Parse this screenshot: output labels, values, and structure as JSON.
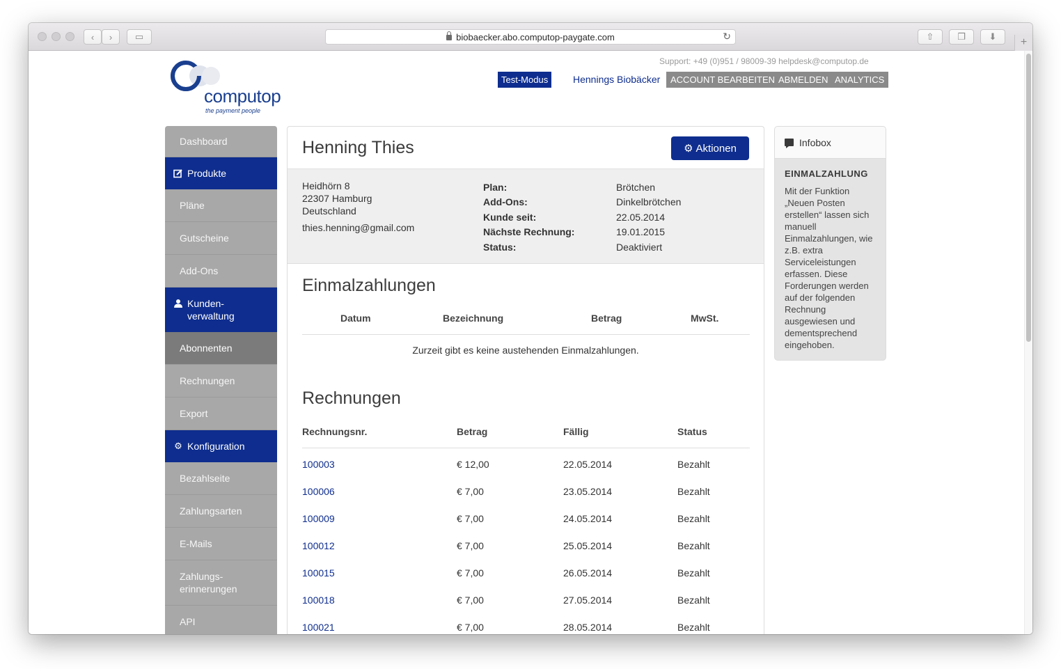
{
  "browser": {
    "url": "biobaecker.abo.computop-paygate.com",
    "new_tab": "+"
  },
  "header": {
    "support": "Support: +49 (0)951 / 98009-39   helpdesk@computop.de",
    "logo_word": "computop",
    "logo_tagline": "the payment people",
    "test_mode": "Test-Modus",
    "merchant": "Hennings Biobäcker",
    "account": "ACCOUNT BEARBEITEN",
    "logout": "ABMELDEN",
    "analytics": "ANALYTICS"
  },
  "sidebar": {
    "dashboard": "Dashboard",
    "produkte": "Produkte",
    "plaene": "Pläne",
    "gutscheine": "Gutscheine",
    "addons": "Add-Ons",
    "kundenverwaltung": "Kunden-\nverwaltung",
    "abonnenten": "Abonnenten",
    "rechnungen": "Rechnungen",
    "export": "Export",
    "konfiguration": "Konfiguration",
    "bezahlseite": "Bezahlseite",
    "zahlungsarten": "Zahlungsarten",
    "emails": "E-Mails",
    "zahlungserinnerungen": "Zahlungs-\nerinnerungen",
    "api": "API"
  },
  "customer": {
    "name": "Henning Thies",
    "actions_label": "Aktionen",
    "street": "Heidhörn 8",
    "city": "22307 Hamburg",
    "country": "Deutschland",
    "email": "thies.henning@gmail.com",
    "details": [
      {
        "key": "Plan:",
        "value": "Brötchen"
      },
      {
        "key": "Add-Ons:",
        "value": "Dinkelbrötchen"
      },
      {
        "key": "Kunde seit:",
        "value": "22.05.2014"
      },
      {
        "key": "Nächste Rechnung:",
        "value": "19.01.2015"
      },
      {
        "key": "Status:",
        "value": "Deaktiviert"
      }
    ]
  },
  "einmalzahlungen": {
    "title": "Einmalzahlungen",
    "columns": [
      "Datum",
      "Bezeichnung",
      "Betrag",
      "MwSt."
    ],
    "empty": "Zurzeit gibt es keine austehenden Einmalzahlungen."
  },
  "rechnungen": {
    "title": "Rechnungen",
    "columns": [
      "Rechnungsnr.",
      "Betrag",
      "Fällig",
      "Status"
    ],
    "rows": [
      {
        "nr": "100003",
        "betrag": "€ 12,00",
        "faellig": "22.05.2014",
        "status": "Bezahlt"
      },
      {
        "nr": "100006",
        "betrag": "€ 7,00",
        "faellig": "23.05.2014",
        "status": "Bezahlt"
      },
      {
        "nr": "100009",
        "betrag": "€ 7,00",
        "faellig": "24.05.2014",
        "status": "Bezahlt"
      },
      {
        "nr": "100012",
        "betrag": "€ 7,00",
        "faellig": "25.05.2014",
        "status": "Bezahlt"
      },
      {
        "nr": "100015",
        "betrag": "€ 7,00",
        "faellig": "26.05.2014",
        "status": "Bezahlt"
      },
      {
        "nr": "100018",
        "betrag": "€ 7,00",
        "faellig": "27.05.2014",
        "status": "Bezahlt"
      },
      {
        "nr": "100021",
        "betrag": "€ 7,00",
        "faellig": "28.05.2014",
        "status": "Bezahlt"
      }
    ]
  },
  "infobox": {
    "header": "Infobox",
    "title": "EINMALZAHLUNG",
    "text": "Mit der Funktion „Neuen Posten erstellen“ lassen sich manuell Einmalzahlungen, wie z.B. extra Serviceleistungen erfassen. Diese Forderungen werden auf der folgenden Rechnung ausgewiesen und dementsprechend eingehoben."
  },
  "colors": {
    "brand_blue": "#0e2d8e",
    "nav_gray": "#a8a8a8",
    "nav_active": "#7b7b7b",
    "header_btn": "#8a8a8a"
  }
}
